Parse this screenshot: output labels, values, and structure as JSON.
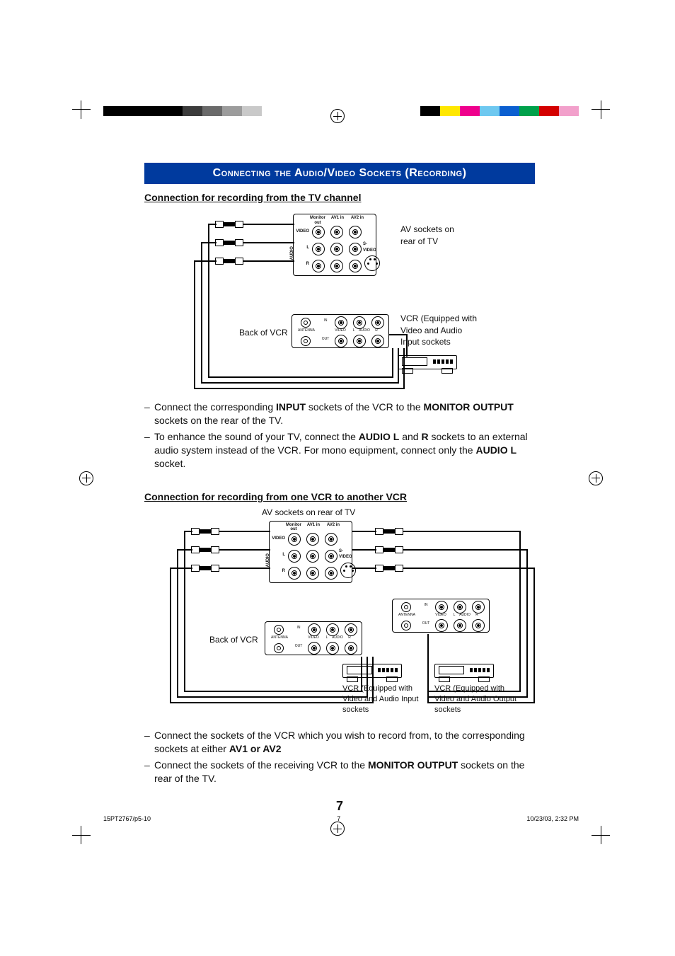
{
  "header_title": "Connecting the Audio/Video  Sockets (Recording)",
  "section1": {
    "subtitle": "Connection for recording from the TV channel",
    "tv_caption": "AV sockets on rear of TV",
    "vcr_side_label": "Back of VCR",
    "vcr_caption": "VCR (Equipped with Video and Audio Input sockets",
    "bullets": [
      "Connect the corresponding <b>INPUT</b> sockets of the VCR to the <b>MONITOR OUTPUT</b> sockets on the rear of the TV.",
      "To enhance the sound of your TV, connect the <b>AUDIO L</b> and <b>R</b> sockets to an external audio system instead of the VCR.  For mono equipment, connect only the <b>AUDIO L</b> socket."
    ]
  },
  "socket_labels": {
    "col_monitor": "Monitor out",
    "col_av1": "AV1 in",
    "col_av2": "AV2 in",
    "row_video": "VIDEO",
    "row_l": "L",
    "row_r": "R",
    "row_audio": "AUDIO",
    "svideo": "S-VIDEO"
  },
  "vcr_labels": {
    "antenna": "ANTENNA",
    "video": "VIDEO",
    "l": "L",
    "audio": "AUDIO",
    "r": "R",
    "in": "IN",
    "out": "OUT"
  },
  "section2": {
    "subtitle": "Connection for recording from one VCR to another VCR",
    "tv_caption_top": "AV sockets on rear of TV",
    "vcr_side_label": "Back of VCR",
    "vcr1_caption": "VCR (Equipped with Video and Audio Input sockets",
    "vcr2_caption": "VCR (Equipped with Video and Audio Output sockets",
    "bullets": [
      "Connect the sockets of the VCR which you wish to record from, to the corresponding sockets at either <b>AV1 or AV2</b>",
      "Connect the sockets of the receiving VCR to the <b>MONITOR OUTPUT</b> sockets on the rear of the TV."
    ]
  },
  "page_number": "7",
  "footer": {
    "left": "15PT2767/p5-10",
    "mid": "7",
    "right": "10/23/03, 2:32 PM"
  },
  "swatches_left": [
    "#000",
    "#000",
    "#000",
    "#000",
    "#3b3b3b",
    "#6a6a6a",
    "#9c9c9c",
    "#c9c9c9",
    "#fff"
  ],
  "swatches_right": [
    "#f2a0cb",
    "#d40000",
    "#00a14b",
    "#0b5fd0",
    "#6ec8f0",
    "#ef008c",
    "#ffe700",
    "#000",
    "#fff"
  ]
}
